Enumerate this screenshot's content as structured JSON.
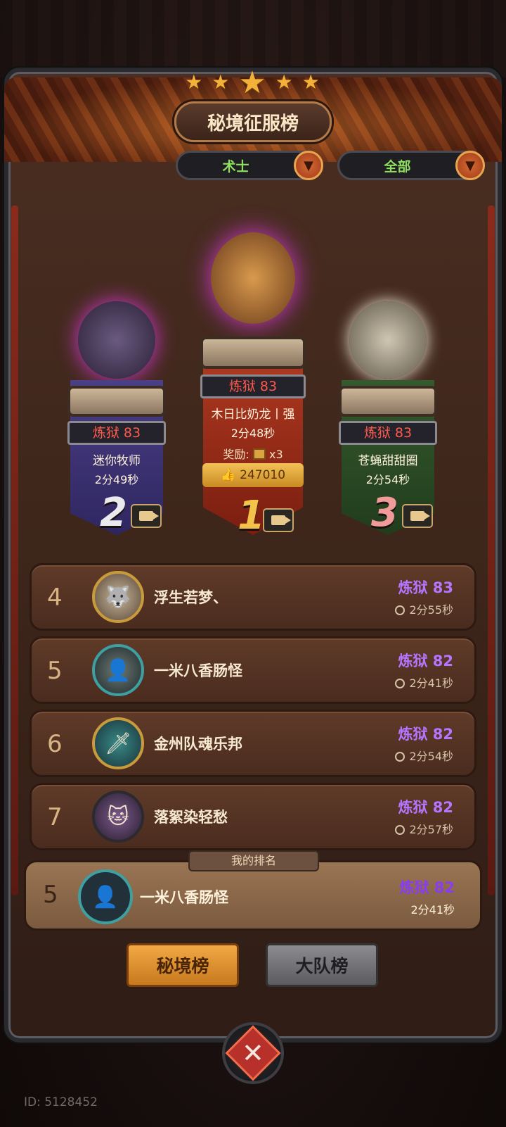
{
  "header": {
    "title": "秘境征服榜",
    "stars": "★ ★ ★ ★ ★"
  },
  "filters": {
    "class_label": "术士",
    "scope_label": "全部"
  },
  "podium": [
    {
      "rank": "1",
      "tier": "炼狱 83",
      "name": "木日比奶龙丨强",
      "time": "2分48秒",
      "reward_label": "奖励:",
      "reward_count": "x3",
      "likes": "247010",
      "color": "#b43c22"
    },
    {
      "rank": "2",
      "tier": "炼狱 83",
      "name": "迷你牧师",
      "time": "2分49秒",
      "color": "#4b3f86"
    },
    {
      "rank": "3",
      "tier": "炼狱 83",
      "name": "苍蝇甜甜圈",
      "time": "2分54秒",
      "color": "#355a2e"
    }
  ],
  "list": [
    {
      "rank": "4",
      "name": "浮生若梦、",
      "tier": "炼狱 83",
      "time": "2分55秒",
      "avatar_icon": "wolf-avatar-icon"
    },
    {
      "rank": "5",
      "name": "一米八香肠怪",
      "tier": "炼狱 82",
      "time": "2分41秒",
      "avatar_icon": "hooded-avatar-icon"
    },
    {
      "rank": "6",
      "name": "金州队魂乐邦",
      "tier": "炼狱 82",
      "time": "2分54秒",
      "avatar_icon": "warrior-avatar-icon"
    },
    {
      "rank": "7",
      "name": "落絮染轻愁",
      "tier": "炼狱 82",
      "time": "2分57秒",
      "avatar_icon": "cat-avatar-icon"
    }
  ],
  "my_rank": {
    "tag": "我的排名",
    "rank": "5",
    "name": "一米八香肠怪",
    "tier": "炼狱 82",
    "time": "2分41秒"
  },
  "tabs": {
    "secret_realm": "秘境榜",
    "team": "大队榜"
  },
  "close_label": "✕",
  "user_id": "ID: 5128452"
}
